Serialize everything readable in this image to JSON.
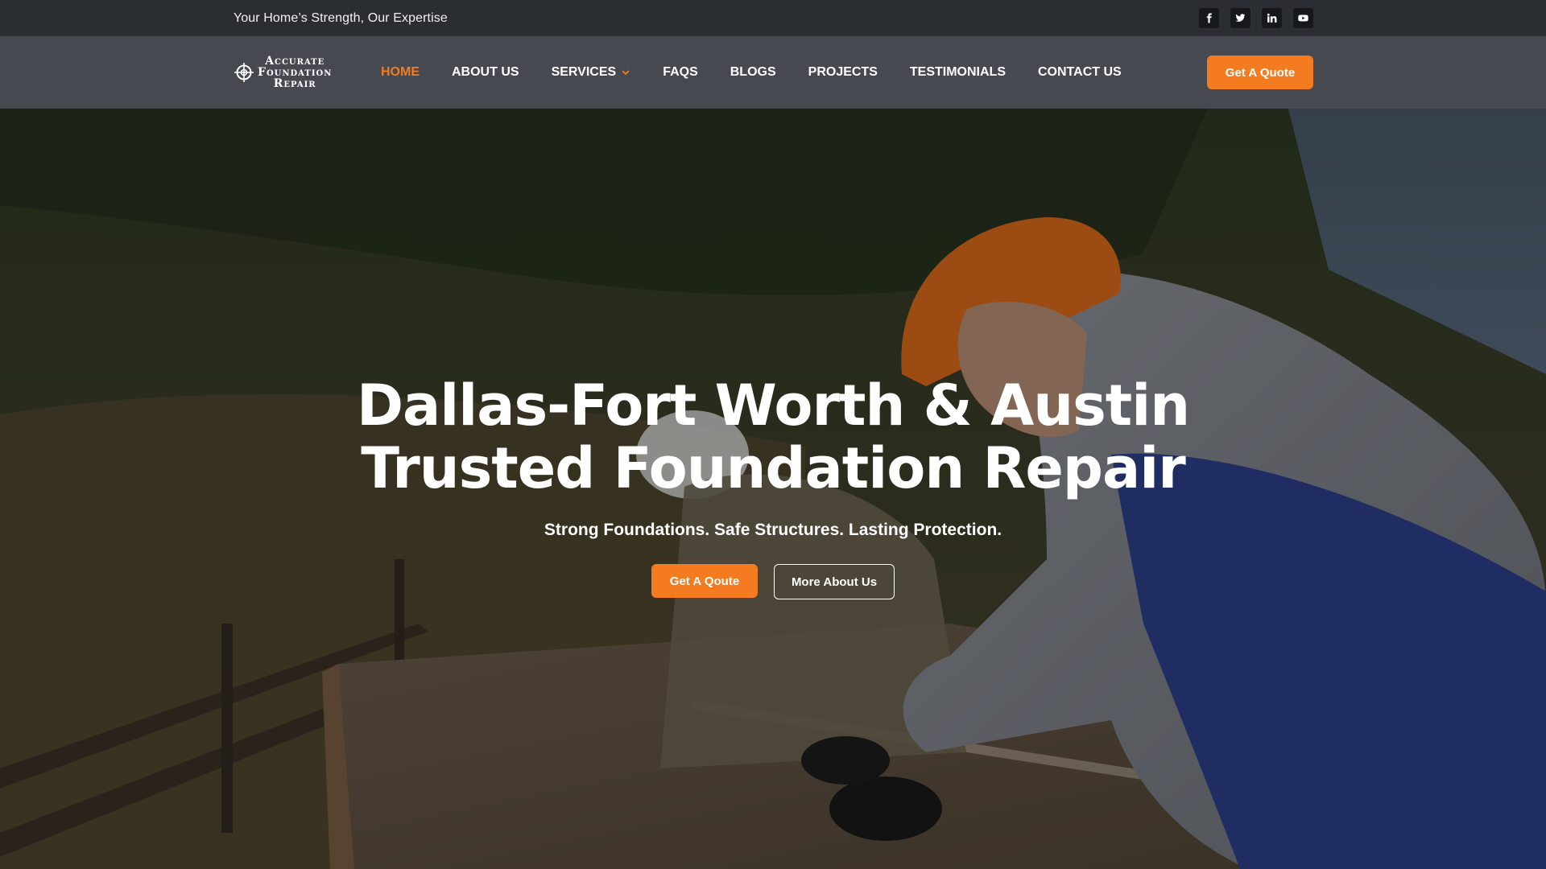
{
  "topbar": {
    "tagline": "Your Home’s Strength, Our Expertise",
    "socials": [
      "facebook-icon",
      "twitter-icon",
      "linkedin-icon",
      "youtube-icon"
    ]
  },
  "brand": {
    "line1": "Accurate",
    "line2": "Foundation",
    "line3": "Repair"
  },
  "nav": {
    "items": [
      {
        "label": "HOME",
        "active": true
      },
      {
        "label": "ABOUT US"
      },
      {
        "label": "SERVICES",
        "has_dropdown": true
      },
      {
        "label": "FAQS"
      },
      {
        "label": "BLOGS"
      },
      {
        "label": "PROJECTS"
      },
      {
        "label": "TESTIMONIALS"
      },
      {
        "label": "CONTACT US"
      }
    ],
    "cta_label": "Get A Quote"
  },
  "hero": {
    "title_line1": "Dallas-Fort Worth & Austin",
    "title_line2": "Trusted Foundation Repair",
    "subtitle": "Strong Foundations. Safe Structures. Lasting Protection.",
    "primary_button": "Get A Qoute",
    "secondary_button": "More About Us"
  },
  "colors": {
    "accent": "#f47b20",
    "topbar_bg": "#2a2d31",
    "navbar_bg": "#464a50"
  }
}
